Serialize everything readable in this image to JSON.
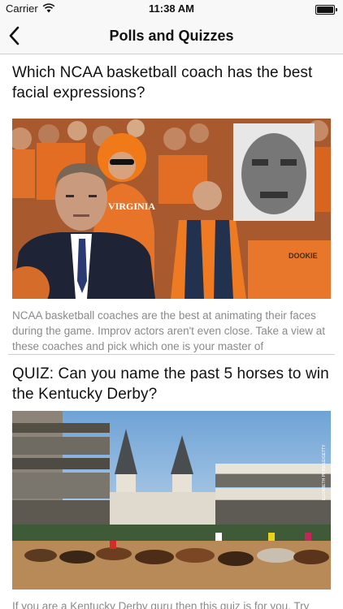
{
  "status_bar": {
    "carrier": "Carrier",
    "time": "11:38 AM",
    "battery_level": 1.0
  },
  "nav": {
    "title": "Polls and Quizzes",
    "back_icon": "chevron-left-icon"
  },
  "feed": [
    {
      "title": "Which NCAA basketball coach has the best facial expressions?",
      "description": "NCAA basketball coaches are the best at animating their faces during the game. Improv actors aren't even close. Take a view at these coaches and pick which one is your master of",
      "image_text": {
        "shirt": "VIRGINIA",
        "sign": "DOOKIE"
      }
    },
    {
      "title": "QUIZ: Can you name the past 5 horses to win the Kentucky Derby?",
      "description": "If you are a Kentucky Derby guru then this quiz is for you. Try",
      "image_text": {
        "credit": "ELIZABETH PRINGLE/GETTY"
      }
    }
  ],
  "colors": {
    "nav_bg": "#f8f8f8",
    "text_primary": "#111111",
    "text_secondary": "#8a8a8a",
    "divider": "#cfcfcf"
  }
}
